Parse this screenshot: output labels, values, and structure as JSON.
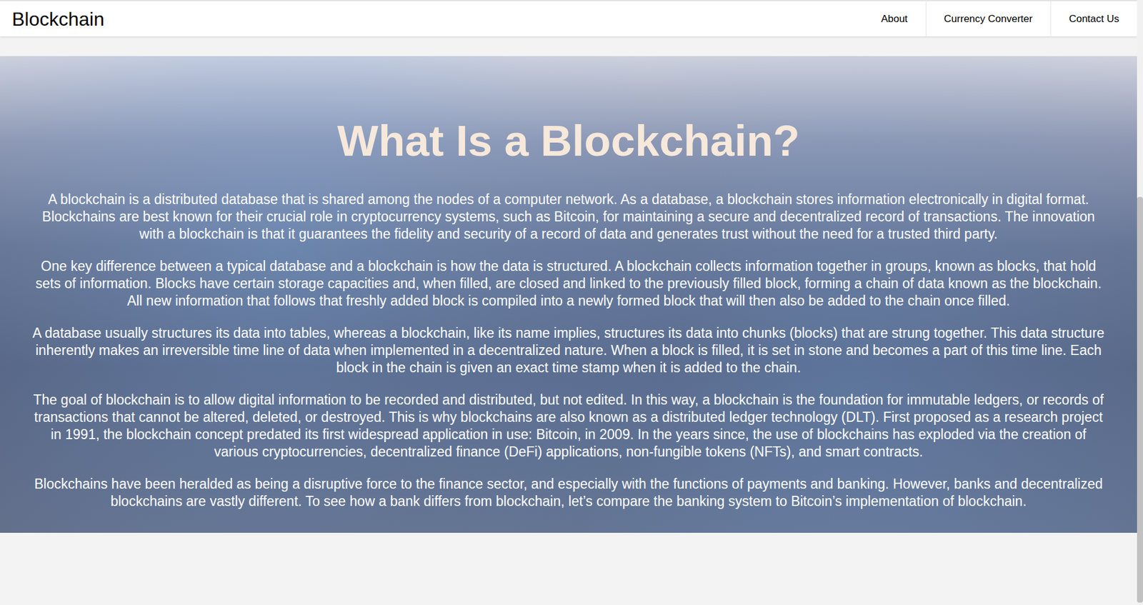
{
  "nav": {
    "brand": "Blockchain",
    "links": [
      {
        "label": "About"
      },
      {
        "label": "Currency Converter"
      },
      {
        "label": "Contact Us"
      }
    ]
  },
  "hero": {
    "heading": "What Is a Blockchain?",
    "paragraphs": [
      "A blockchain is a distributed database that is shared among the nodes of a computer network. As a database, a blockchain stores information electronically in digital format. Blockchains are best known for their crucial role in cryptocurrency systems, such as Bitcoin, for maintaining a secure and decentralized record of transactions. The innovation with a blockchain is that it guarantees the fidelity and security of a record of data and generates trust without the need for a trusted third party.",
      "One key difference between a typical database and a blockchain is how the data is structured. A blockchain collects information together in groups, known as blocks, that hold sets of information. Blocks have certain storage capacities and, when filled, are closed and linked to the previously filled block, forming a chain of data known as the blockchain. All new information that follows that freshly added block is compiled into a newly formed block that will then also be added to the chain once filled.",
      "A database usually structures its data into tables, whereas a blockchain, like its name implies, structures its data into chunks (blocks) that are strung together. This data structure inherently makes an irreversible time line of data when implemented in a decentralized nature. When a block is filled, it is set in stone and becomes a part of this time line. Each block in the chain is given an exact time stamp when it is added to the chain.",
      "The goal of blockchain is to allow digital information to be recorded and distributed, but not edited. In this way, a blockchain is the foundation for immutable ledgers, or records of transactions that cannot be altered, deleted, or destroyed. This is why blockchains are also known as a distributed ledger technology (DLT). First proposed as a research project in 1991, the blockchain concept predated its first widespread application in use: Bitcoin, in 2009. In the years since, the use of blockchains has exploded via the creation of various cryptocurrencies, decentralized finance (DeFi) applications, non-fungible tokens (NFTs), and smart contracts.",
      "Blockchains have been heralded as being a disruptive force to the finance sector, and especially with the functions of payments and banking. However, banks and decentralized blockchains are vastly different. To see how a bank differs from blockchain, let’s compare the banking system to Bitcoin’s implementation of blockchain."
    ]
  }
}
